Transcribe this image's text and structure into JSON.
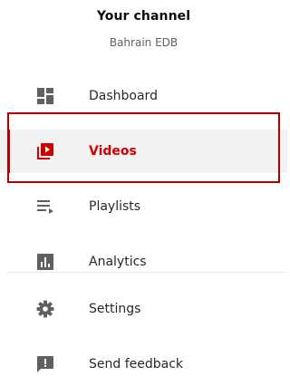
{
  "header": {
    "title": "Your channel",
    "channel_name": "Bahrain EDB"
  },
  "nav": {
    "items": [
      {
        "label": "Dashboard",
        "icon": "dashboard-icon",
        "active": false
      },
      {
        "label": "Videos",
        "icon": "videos-icon",
        "active": true
      },
      {
        "label": "Playlists",
        "icon": "playlists-icon",
        "active": false
      },
      {
        "label": "Analytics",
        "icon": "analytics-icon",
        "active": false
      },
      {
        "label": "Settings",
        "icon": "gear-icon",
        "active": false
      },
      {
        "label": "Send feedback",
        "icon": "feedback-icon",
        "active": false
      }
    ]
  },
  "colors": {
    "accent": "#cc0000",
    "icon": "#606060",
    "text": "#282828",
    "active_background": "#f2f2f2",
    "highlight_border": "#b00000"
  }
}
